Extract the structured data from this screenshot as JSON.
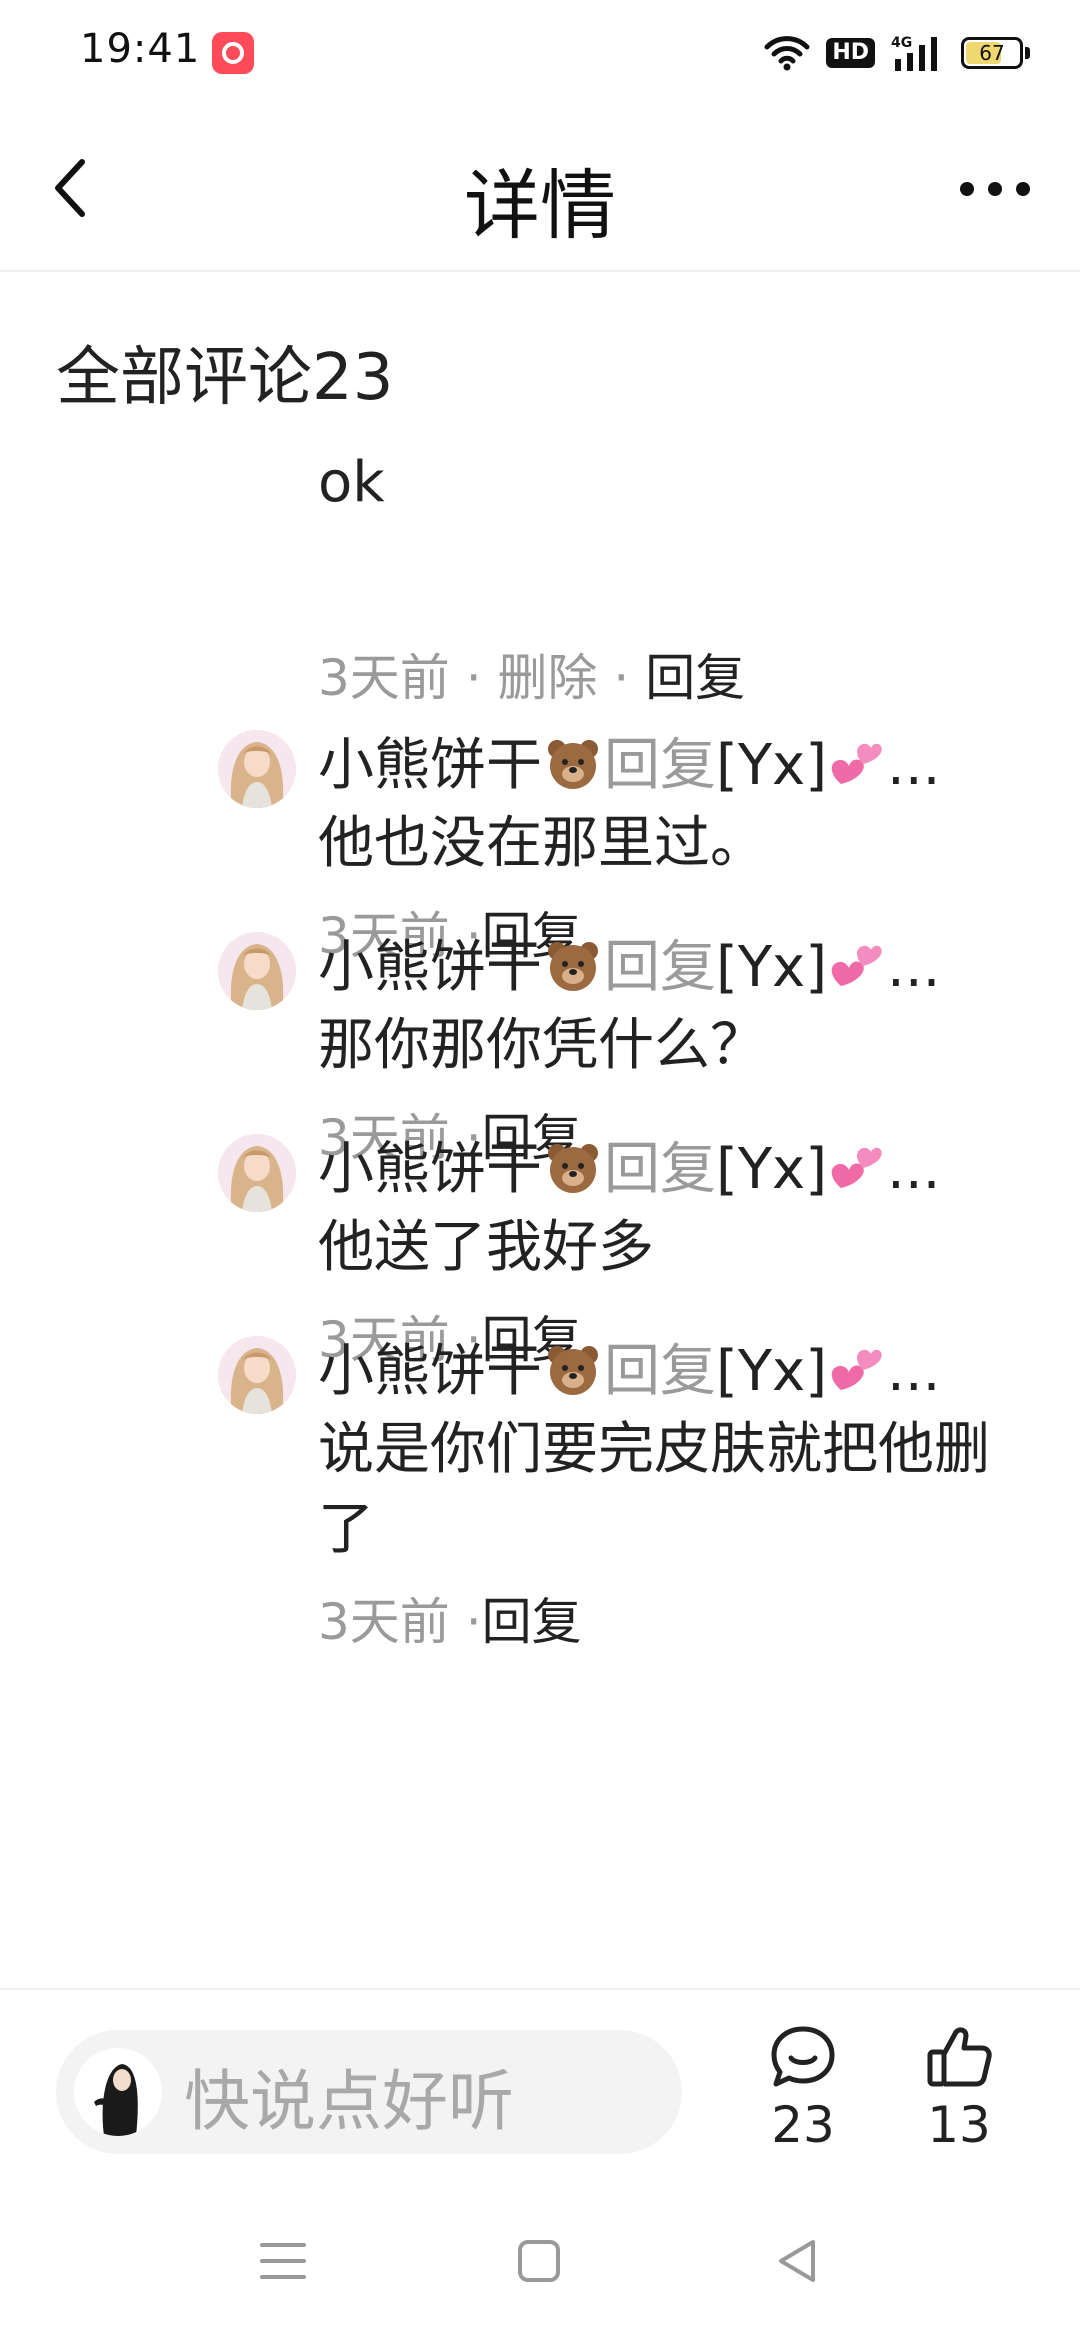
{
  "status_bar": {
    "time": "19:41",
    "hd": "HD",
    "network": "4G",
    "battery": "67",
    "battery_level": 0.67
  },
  "header": {
    "title": "详情",
    "back_icon": "chevron-left-icon",
    "more_icon": "more-horizontal-icon"
  },
  "comments": {
    "section_title": "全部评论23",
    "first": {
      "text": "ok",
      "time": "3天前",
      "sep1": " · ",
      "delete": "删除",
      "sep2": " · ",
      "reply": "回复"
    },
    "replies": [
      {
        "author": "小熊饼干",
        "action": "回复",
        "target": "[Yx]",
        "ellipsis": "...",
        "text": "他也没在那里过。",
        "time": "3天前",
        "sep": " ·",
        "reply": "回复"
      },
      {
        "author": "小熊饼干",
        "action": "回复",
        "target": "[Yx]",
        "ellipsis": "...",
        "text": "那你那你凭什么？",
        "time": "3天前",
        "sep": " ·",
        "reply": "回复"
      },
      {
        "author": "小熊饼干",
        "action": "回复",
        "target": "[Yx]",
        "ellipsis": "...",
        "text": "他送了我好多",
        "time": "3天前",
        "sep": " ·",
        "reply": "回复"
      },
      {
        "author": "小熊饼干",
        "action": "回复",
        "target": "[Yx]",
        "ellipsis": "...",
        "text": "说是你们要完皮肤就把他删了",
        "time": "3天前",
        "sep": " ·",
        "reply": "回复"
      }
    ]
  },
  "bottom_bar": {
    "placeholder": "快说点好听",
    "placeholder_cont": "··",
    "comment_count": "23",
    "like_count": "13"
  },
  "colors": {
    "text": "#222222",
    "muted": "#9a9a9a",
    "input_bg": "#f3f3f3",
    "divider": "#eeeeee"
  }
}
